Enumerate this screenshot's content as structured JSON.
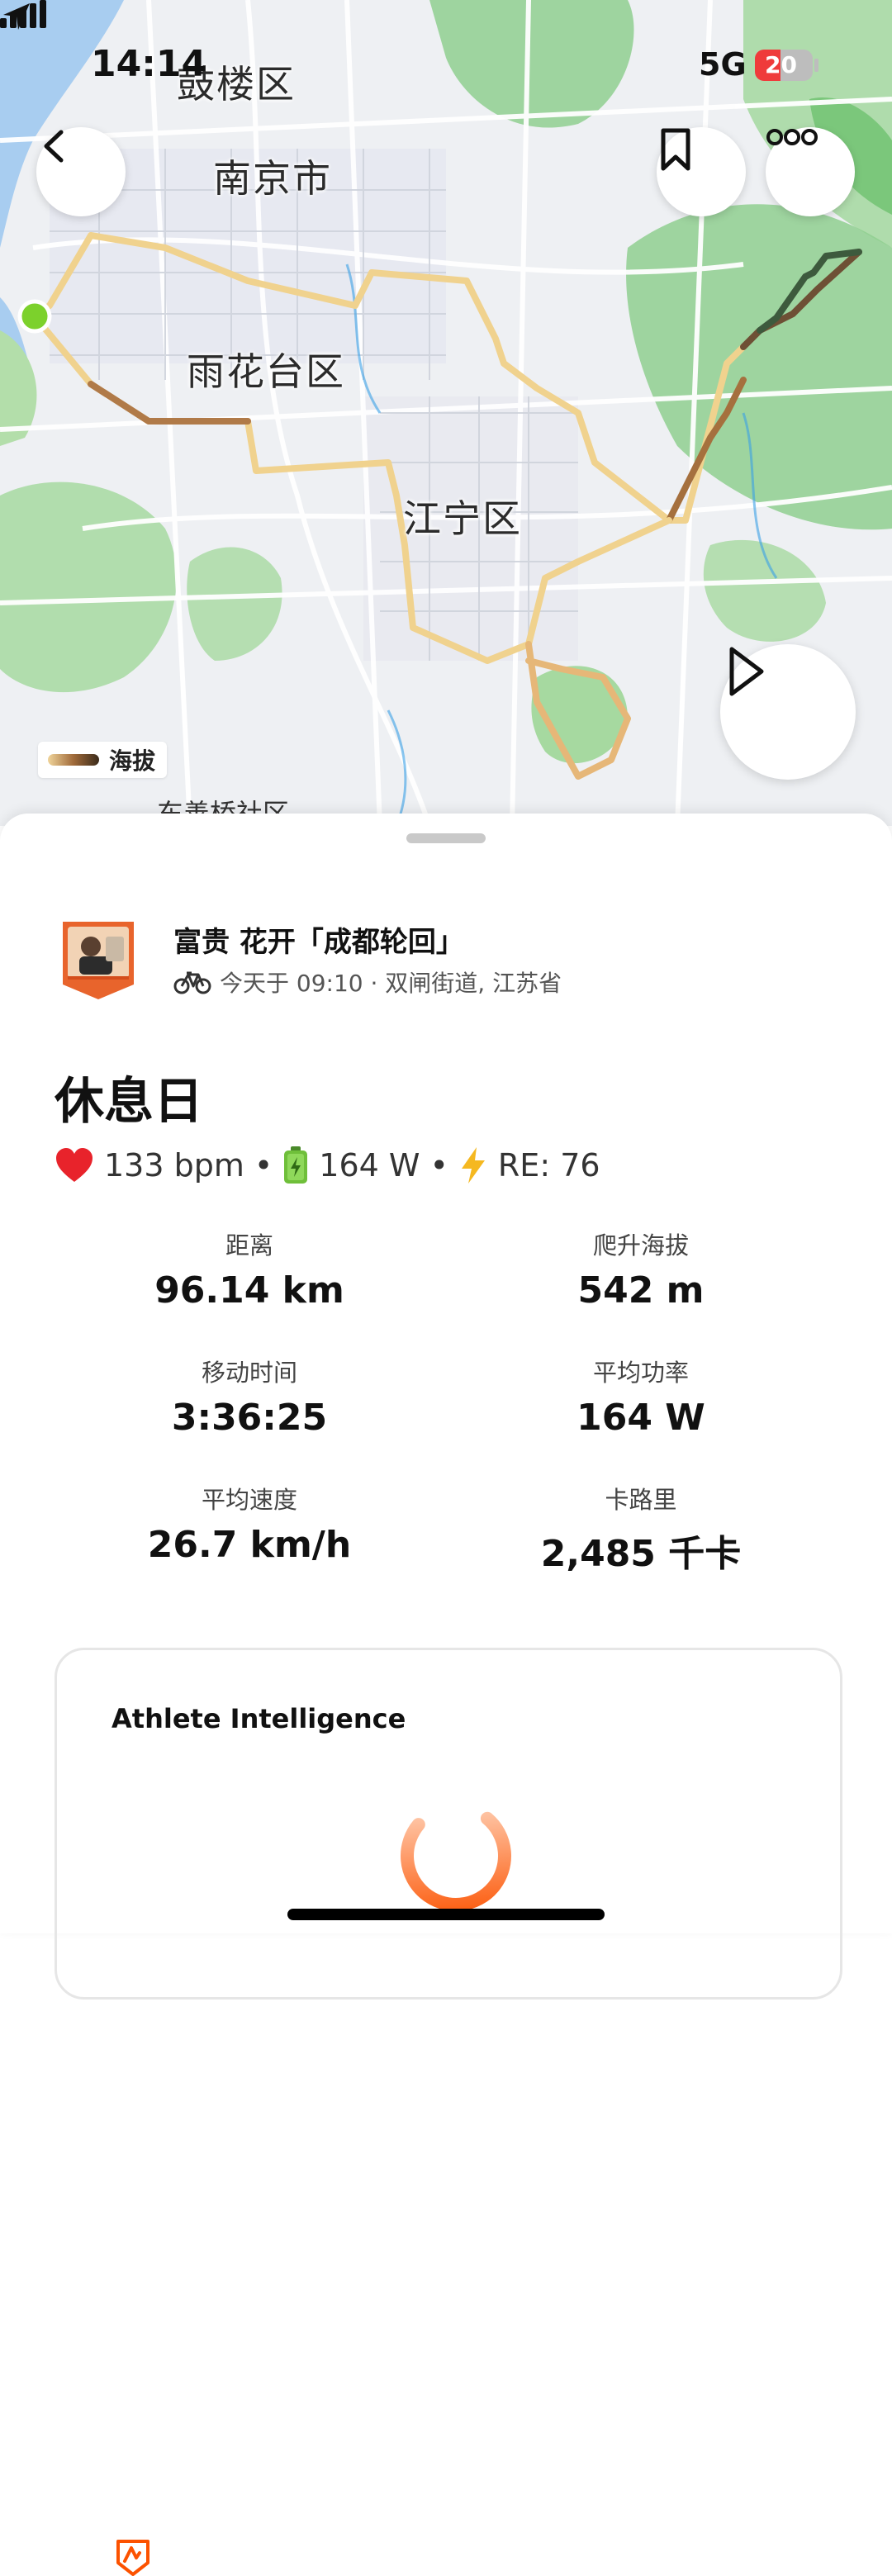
{
  "status_bar": {
    "time": "14:14",
    "network": "5G",
    "battery_percent": "20",
    "battery_level": 0.2,
    "battery_color": "#ef3b3b"
  },
  "map": {
    "labels": {
      "gulou": "鼓楼区",
      "nanjing": "南京市",
      "yuhuatai": "雨花台区",
      "jiangning": "江宁区",
      "bottom": "东善桥社区"
    },
    "legend_label": "海拔",
    "icons": {
      "back": "chevron-left-icon",
      "save": "bookmark-icon",
      "more": "more-dots-icon",
      "play": "play-icon",
      "start": "start-dot-icon"
    },
    "route_color": "#f0d28e",
    "start_color": "#7cd12c"
  },
  "activity": {
    "title": "富贵 花开「成都轮回」",
    "meta": "今天于 09:10 · 双闸街道, 江苏省",
    "name": "休息日",
    "highlight": {
      "heart_rate": "133 bpm",
      "power": "164 W",
      "re": "RE: 76",
      "separator": "•"
    }
  },
  "stats": [
    {
      "label": "距离",
      "value": "96.14 km"
    },
    {
      "label": "爬升海拔",
      "value": "542 m"
    },
    {
      "label": "移动时间",
      "value": "3:36:25"
    },
    {
      "label": "平均功率",
      "value": "164 W"
    },
    {
      "label": "平均速度",
      "value": "26.7 km/h"
    },
    {
      "label": "卡路里",
      "value": "2,485 千卡"
    }
  ],
  "athlete_intelligence": {
    "title": "Athlete Intelligence",
    "accent": "#fc5200"
  }
}
